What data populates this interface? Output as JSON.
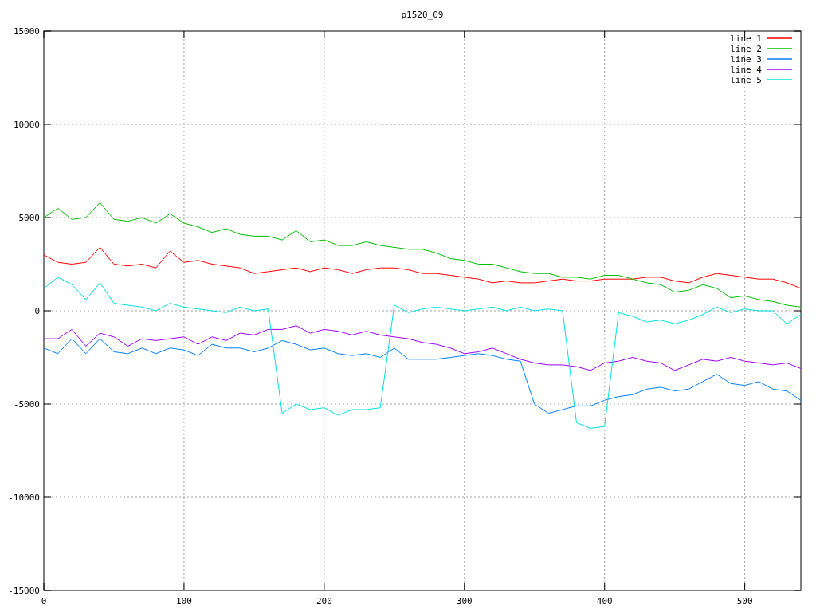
{
  "chart_data": {
    "type": "line",
    "title": "p1520_09",
    "grid": true,
    "legend": true,
    "xlim": [
      0,
      540
    ],
    "ylim": [
      -15000,
      15000
    ],
    "xticks": [
      0,
      100,
      200,
      300,
      400,
      500
    ],
    "yticks": [
      -15000,
      -10000,
      -5000,
      0,
      5000,
      10000,
      15000
    ],
    "x": [
      0,
      10,
      20,
      30,
      40,
      50,
      60,
      70,
      80,
      90,
      100,
      110,
      120,
      130,
      140,
      150,
      160,
      170,
      180,
      190,
      200,
      210,
      220,
      230,
      240,
      250,
      260,
      270,
      280,
      290,
      300,
      310,
      320,
      330,
      340,
      350,
      360,
      370,
      380,
      390,
      400,
      410,
      420,
      430,
      440,
      450,
      460,
      470,
      480,
      490,
      500,
      510,
      520,
      530,
      540
    ],
    "series": [
      {
        "name": "line 1",
        "color": "#ff0000",
        "values": [
          3000,
          2600,
          2500,
          2600,
          3400,
          2500,
          2400,
          2500,
          2300,
          3200,
          2600,
          2700,
          2500,
          2400,
          2300,
          2000,
          2100,
          2200,
          2300,
          2100,
          2300,
          2200,
          2000,
          2200,
          2300,
          2300,
          2200,
          2000,
          2000,
          1900,
          1800,
          1700,
          1500,
          1600,
          1500,
          1500,
          1600,
          1700,
          1600,
          1600,
          1700,
          1700,
          1700,
          1800,
          1800,
          1600,
          1500,
          1800,
          2000,
          1900,
          1800,
          1700,
          1700,
          1500,
          1200
        ]
      },
      {
        "name": "line 2",
        "color": "#00c000",
        "values": [
          5000,
          5500,
          4900,
          5000,
          5800,
          4900,
          4800,
          5000,
          4700,
          5200,
          4700,
          4500,
          4200,
          4400,
          4100,
          4000,
          4000,
          3800,
          4300,
          3700,
          3800,
          3500,
          3500,
          3700,
          3500,
          3400,
          3300,
          3300,
          3100,
          2800,
          2700,
          2500,
          2500,
          2300,
          2100,
          2000,
          2000,
          1800,
          1800,
          1700,
          1900,
          1900,
          1700,
          1500,
          1400,
          1000,
          1100,
          1400,
          1200,
          700,
          800,
          600,
          500,
          300,
          200
        ]
      },
      {
        "name": "line 3",
        "color": "#0080ff",
        "values": [
          -2000,
          -2300,
          -1500,
          -2300,
          -1500,
          -2200,
          -2300,
          -2000,
          -2300,
          -2000,
          -2100,
          -2400,
          -1800,
          -2000,
          -2000,
          -2200,
          -2000,
          -1600,
          -1800,
          -2100,
          -2000,
          -2300,
          -2400,
          -2300,
          -2500,
          -2000,
          -2600,
          -2600,
          -2600,
          -2500,
          -2400,
          -2300,
          -2400,
          -2600,
          -2700,
          -5000,
          -5500,
          -5300,
          -5100,
          -5100,
          -4800,
          -4600,
          -4500,
          -4200,
          -4100,
          -4300,
          -4200,
          -3800,
          -3400,
          -3900,
          -4000,
          -3800,
          -4200,
          -4300,
          -4800
        ]
      },
      {
        "name": "line 4",
        "color": "#a000ff",
        "values": [
          -1500,
          -1500,
          -1000,
          -1900,
          -1200,
          -1400,
          -1900,
          -1500,
          -1600,
          -1500,
          -1400,
          -1800,
          -1400,
          -1600,
          -1200,
          -1300,
          -1000,
          -1000,
          -800,
          -1200,
          -1000,
          -1100,
          -1300,
          -1100,
          -1300,
          -1400,
          -1500,
          -1700,
          -1800,
          -2000,
          -2300,
          -2200,
          -2000,
          -2300,
          -2600,
          -2800,
          -2900,
          -2900,
          -3000,
          -3200,
          -2800,
          -2700,
          -2500,
          -2700,
          -2800,
          -3200,
          -2900,
          -2600,
          -2700,
          -2500,
          -2700,
          -2800,
          -2900,
          -2800,
          -3100
        ]
      },
      {
        "name": "line 5",
        "color": "#00e0e0",
        "values": [
          1200,
          1800,
          1400,
          600,
          1500,
          400,
          300,
          200,
          0,
          400,
          200,
          100,
          0,
          -100,
          200,
          0,
          100,
          -5500,
          -5000,
          -5300,
          -5200,
          -5600,
          -5300,
          -5300,
          -5200,
          300,
          -100,
          100,
          200,
          100,
          0,
          100,
          200,
          0,
          200,
          0,
          100,
          0,
          -6000,
          -6300,
          -6200,
          -100,
          -300,
          -600,
          -500,
          -700,
          -500,
          -200,
          200,
          -100,
          100,
          0,
          0,
          -700,
          -200
        ]
      }
    ]
  }
}
